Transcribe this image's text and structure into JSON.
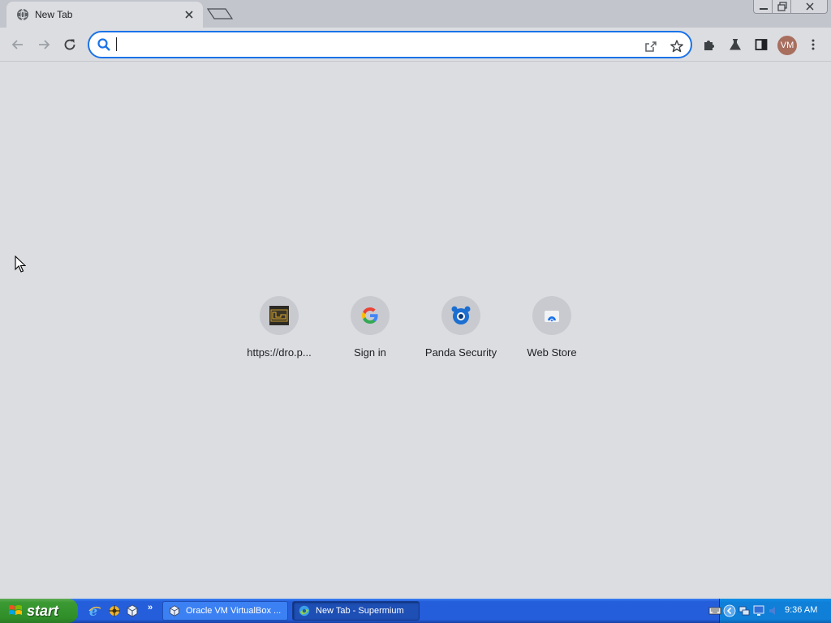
{
  "window": {
    "tab_title": "New Tab"
  },
  "omnibox": {
    "value": "",
    "placeholder": ""
  },
  "toolbar": {
    "back_icon": "arrow-left-icon",
    "forward_icon": "arrow-right-icon",
    "reload_icon": "reload-icon",
    "profile_initials": "VM"
  },
  "shortcuts": [
    {
      "label": "https://dro.p...",
      "icon": "dropbox-site-favicon"
    },
    {
      "label": "Sign in",
      "icon": "google-g-icon"
    },
    {
      "label": "Panda Security",
      "icon": "panda-security-icon"
    },
    {
      "label": "Web Store",
      "icon": "web-store-icon"
    }
  ],
  "taskbar": {
    "start_label": "start",
    "tasks": [
      {
        "label": "Oracle VM VirtualBox ...",
        "icon": "virtualbox-icon"
      },
      {
        "label": "New Tab - Supermium",
        "icon": "supermium-icon"
      }
    ],
    "clock": "9:36 AM"
  },
  "colors": {
    "accent": "#1a73e8",
    "page_background": "#dcdde1",
    "tab_strip": "#c2c5cc",
    "taskbar_blue": "#245edb",
    "start_green": "#3c9a33"
  }
}
